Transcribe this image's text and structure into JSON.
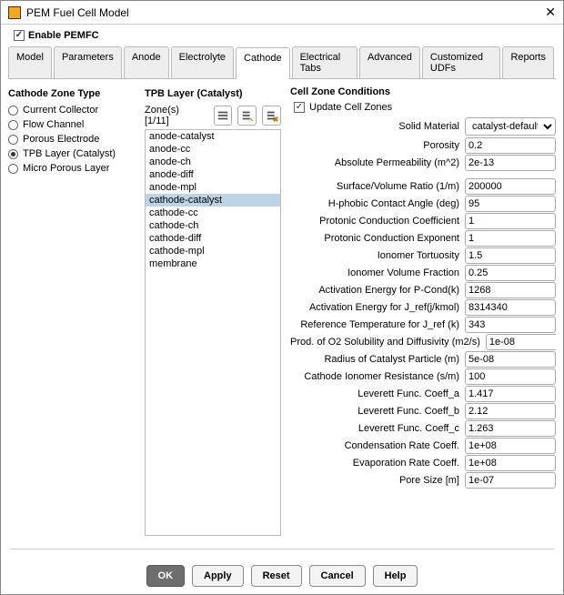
{
  "window": {
    "title": "PEM Fuel Cell Model"
  },
  "enable": {
    "label": "Enable PEMFC",
    "checked": true
  },
  "tabs": {
    "items": [
      {
        "label": "Model"
      },
      {
        "label": "Parameters"
      },
      {
        "label": "Anode"
      },
      {
        "label": "Electrolyte"
      },
      {
        "label": "Cathode",
        "active": true
      },
      {
        "label": "Electrical Tabs"
      },
      {
        "label": "Advanced"
      },
      {
        "label": "Customized UDFs"
      },
      {
        "label": "Reports"
      }
    ]
  },
  "zone_type": {
    "title": "Cathode Zone Type",
    "items": [
      {
        "label": "Current Collector"
      },
      {
        "label": "Flow Channel"
      },
      {
        "label": "Porous Electrode"
      },
      {
        "label": "TPB Layer (Catalyst)",
        "selected": true
      },
      {
        "label": "Micro Porous Layer"
      }
    ]
  },
  "layer": {
    "title": "TPB Layer (Catalyst)",
    "zones_label": "Zone(s) [1/11]",
    "items": [
      "anode-catalyst",
      "anode-cc",
      "anode-ch",
      "anode-diff",
      "anode-mpl",
      "cathode-catalyst",
      "cathode-cc",
      "cathode-ch",
      "cathode-diff",
      "cathode-mpl",
      "membrane"
    ],
    "selected_index": 5
  },
  "cell": {
    "title": "Cell Zone Conditions",
    "update_label": "Update Cell Zones",
    "update_checked": true,
    "solid_material_label": "Solid Material",
    "solid_material_value": "catalyst-default",
    "params": [
      {
        "label": "Porosity",
        "value": "0.2"
      },
      {
        "label": "Absolute Permeability (m^2)",
        "value": "2e-13"
      },
      {
        "label": "Surface/Volume Ratio (1/m)",
        "value": "200000"
      },
      {
        "label": "H-phobic Contact Angle (deg)",
        "value": "95"
      },
      {
        "label": "Protonic Conduction Coefficient",
        "value": "1"
      },
      {
        "label": "Protonic Conduction Exponent",
        "value": "1"
      },
      {
        "label": "Ionomer Tortuosity",
        "value": "1.5"
      },
      {
        "label": "Ionomer Volume Fraction",
        "value": "0.25"
      },
      {
        "label": "Activation Energy for P-Cond(k)",
        "value": "1268"
      },
      {
        "label": "Activation Energy for J_ref(j/kmol)",
        "value": "8314340"
      },
      {
        "label": "Reference Temperature for J_ref (k)",
        "value": "343"
      },
      {
        "label": "Prod. of O2 Solubility and Diffusivity (m2/s)",
        "value": "1e-08"
      },
      {
        "label": "Radius of Catalyst Particle (m)",
        "value": "5e-08"
      },
      {
        "label": "Cathode Ionomer Resistance (s/m)",
        "value": "100"
      },
      {
        "label": "Leverett Func. Coeff_a",
        "value": "1.417"
      },
      {
        "label": "Leverett Func. Coeff_b",
        "value": "2.12"
      },
      {
        "label": "Leverett Func. Coeff_c",
        "value": "1.263"
      },
      {
        "label": "Condensation Rate Coeff.",
        "value": "1e+08"
      },
      {
        "label": "Evaporation Rate Coeff.",
        "value": "1e+08"
      },
      {
        "label": "Pore Size [m]",
        "value": "1e-07"
      }
    ]
  },
  "buttons": {
    "ok": "OK",
    "apply": "Apply",
    "reset": "Reset",
    "cancel": "Cancel",
    "help": "Help"
  }
}
